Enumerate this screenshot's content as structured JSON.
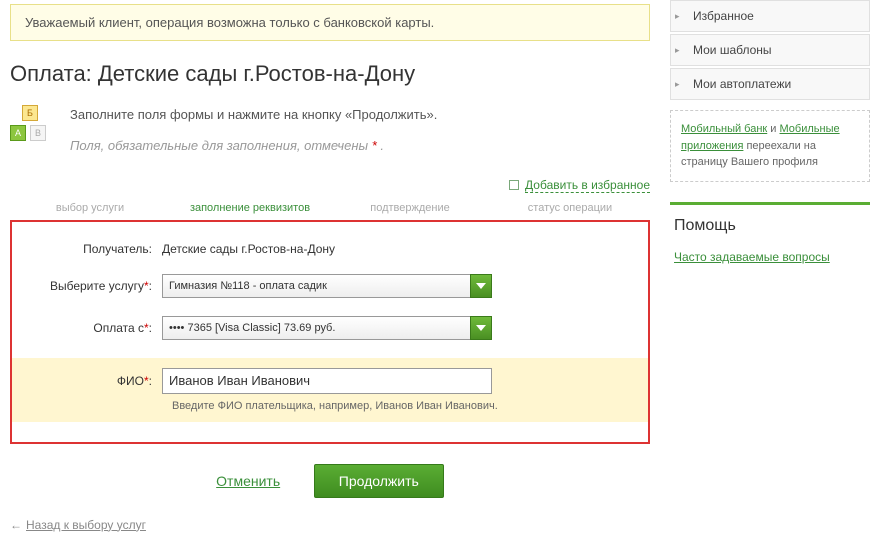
{
  "alert": "Уважаемый клиент, операция возможна только с банковской карты.",
  "page_title": "Оплата: Детские сады г.Ростов-на-Дону",
  "intro": {
    "line1": "Заполните поля формы и нажмите на кнопку «Продолжить».",
    "line2_pre": "Поля, обязательные для заполнения, отмечены ",
    "line2_mark": "*",
    "line2_post": " ."
  },
  "add_favorites": "Добавить в избранное",
  "steps": {
    "s1": "выбор услуги",
    "s2": "заполнение реквизитов",
    "s3": "подтверждение",
    "s4": "статус операции"
  },
  "form": {
    "recipient_label": "Получатель:",
    "recipient_value": "Детские сады г.Ростов-на-Дону",
    "service_label": "Выберите услугу",
    "service_value": "Гимназия №118 - оплата садик",
    "paywith_label": "Оплата с",
    "paywith_value": "•••• 7365 [Visa Classic] 73.69 руб.",
    "fio_label": "ФИО",
    "fio_value": "Иванов Иван Иванович",
    "fio_hint": "Введите ФИО плательщика, например, Иванов Иван Иванович."
  },
  "actions": {
    "cancel": "Отменить",
    "submit": "Продолжить"
  },
  "back_link": "Назад к выбору услуг",
  "sidebar": {
    "items": [
      "Избранное",
      "Мои шаблоны",
      "Мои автоплатежи"
    ],
    "info": {
      "a1": "Мобильный банк",
      "and": " и ",
      "a2": "Мобильные приложения",
      "rest": " переехали на страницу Вашего профиля"
    },
    "help_title": "Помощь",
    "help_link": "Часто задаваемые вопросы"
  }
}
